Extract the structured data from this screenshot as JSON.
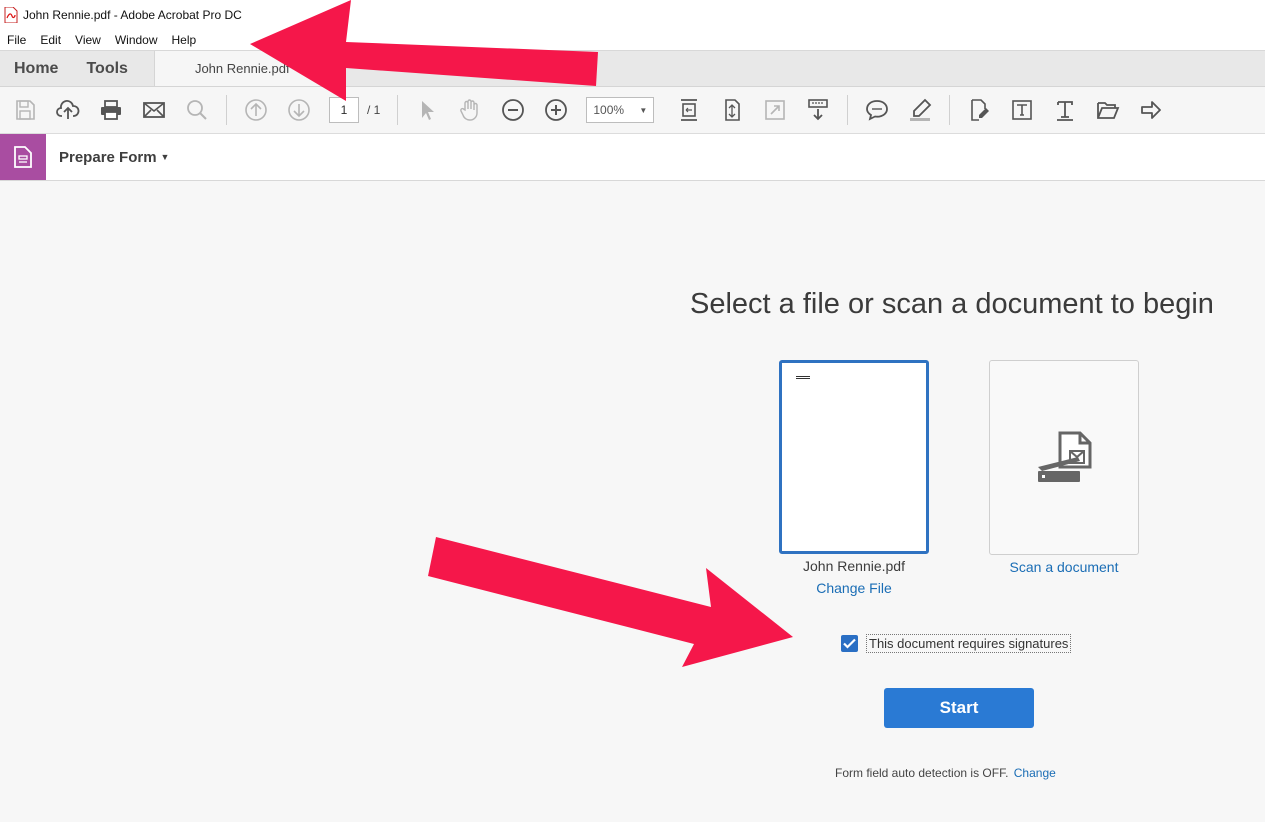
{
  "titlebar": {
    "title": "John Rennie.pdf - Adobe Acrobat Pro DC"
  },
  "menubar": {
    "items": [
      "File",
      "Edit",
      "View",
      "Window",
      "Help"
    ]
  },
  "tabs": {
    "home": "Home",
    "tools": "Tools",
    "document": "John Rennie.pdf"
  },
  "toolbar": {
    "page_current": "1",
    "page_total": "/ 1",
    "zoom": "100%"
  },
  "formbar": {
    "title": "Prepare Form"
  },
  "main": {
    "heading": "Select a file or scan a document to begin",
    "file_name": "John Rennie.pdf",
    "change_file": "Change File",
    "scan_label": "Scan a document",
    "signature_label": "This document requires signatures",
    "signature_checked": true,
    "start_label": "Start",
    "autodetect_text": "Form field auto detection is OFF.",
    "autodetect_link": "Change"
  },
  "colors": {
    "accent": "#2a7ad4",
    "form_icon_bg": "#a94da1",
    "annotation_arrow": "#f5174a"
  }
}
